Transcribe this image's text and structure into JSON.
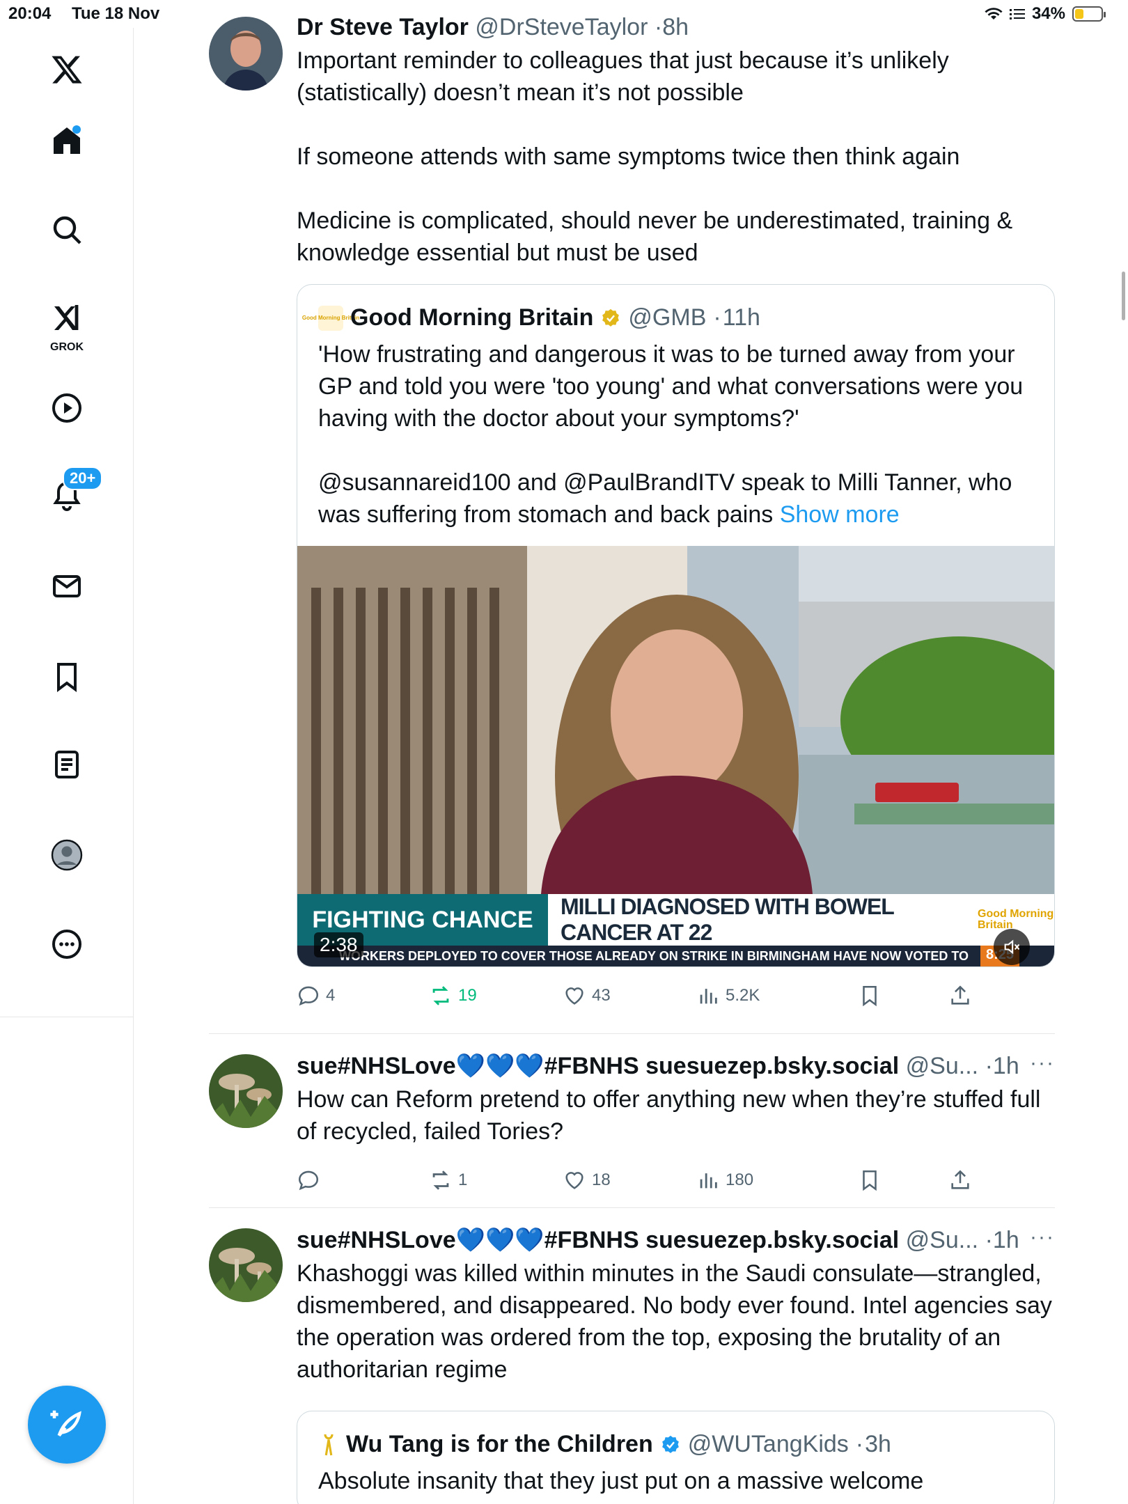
{
  "status_bar": {
    "time": "20:04",
    "date": "Tue 18 Nov",
    "battery": "34%",
    "battery_level": 0.34
  },
  "sidebar": {
    "items": [
      {
        "name": "x-logo",
        "label": "X"
      },
      {
        "name": "home",
        "label": "Home"
      },
      {
        "name": "search",
        "label": "Search"
      },
      {
        "name": "grok",
        "label": "GROK"
      },
      {
        "name": "video",
        "label": "Video"
      },
      {
        "name": "notifications",
        "label": "Notifications",
        "badge": "20+"
      },
      {
        "name": "messages",
        "label": "Messages"
      },
      {
        "name": "bookmarks",
        "label": "Bookmarks"
      },
      {
        "name": "lists",
        "label": "Lists"
      },
      {
        "name": "profile",
        "label": "Profile"
      },
      {
        "name": "more",
        "label": "More"
      }
    ],
    "accent": "#1d9bf0"
  },
  "tweets": [
    {
      "name": "Dr Steve Taylor",
      "handle": "@DrSteveTaylor",
      "time": "8h",
      "paragraphs": [
        "Important reminder to colleagues that just because it’s unlikely (statistically) doesn’t mean it’s not possible",
        "If someone attends with same symptoms twice then think again",
        "Medicine is complicated, should never be underestimated, training & knowledge essential but must be used"
      ],
      "quote": {
        "name": "Good Morning Britain",
        "handle": "@GMB",
        "time": "11h",
        "logo_text": "Good Morning Britain",
        "paragraphs": [
          "'How frustrating and dangerous it was to be turned away from your GP and told you were 'too young' and what conversations were you having with the doctor about your symptoms?'",
          "@susannareid100 and @PaulBrandITV speak to Milli Tanner, who was suffering from stomach and back pains"
        ],
        "show_more": "Show more",
        "video": {
          "duration": "2:38",
          "lower_third_left": "FIGHTING CHANCE",
          "lower_third_right": "MILLI DIAGNOSED WITH BOWEL CANCER AT 22",
          "channel_logo": "Good Morning Britain",
          "ticker": "WORKERS DEPLOYED TO COVER THOSE ALREADY ON STRIKE IN BIRMINGHAM HAVE NOW VOTED TO",
          "ticker_clock": "8:25"
        }
      },
      "stats": {
        "replies": "4",
        "reposts": "19",
        "likes": "43",
        "views": "5.2K"
      }
    },
    {
      "name": "sue#NHSLove💙💙💙#FBNHS suesuezep.bsky.social",
      "handle": "@Su...",
      "time": "1h",
      "paragraphs": [
        "How can Reform pretend to offer anything new when they’re stuffed full of recycled, failed Tories?"
      ],
      "stats": {
        "replies": "",
        "reposts": "1",
        "likes": "18",
        "views": "180"
      }
    },
    {
      "name": "sue#NHSLove💙💙💙#FBNHS suesuezep.bsky.social",
      "handle": "@Su...",
      "time": "1h",
      "paragraphs": [
        "Khashoggi was killed within minutes in the Saudi consulate—strangled, dismembered, and disappeared. No body ever found. Intel agencies say the operation was ordered from the top, exposing the brutality of an authoritarian regime"
      ],
      "quote": {
        "name": "Wu Tang is for the Children",
        "handle": "@WUTangKids",
        "time": "3h",
        "text": "Absolute insanity that they just put on a massive welcome"
      }
    }
  ]
}
